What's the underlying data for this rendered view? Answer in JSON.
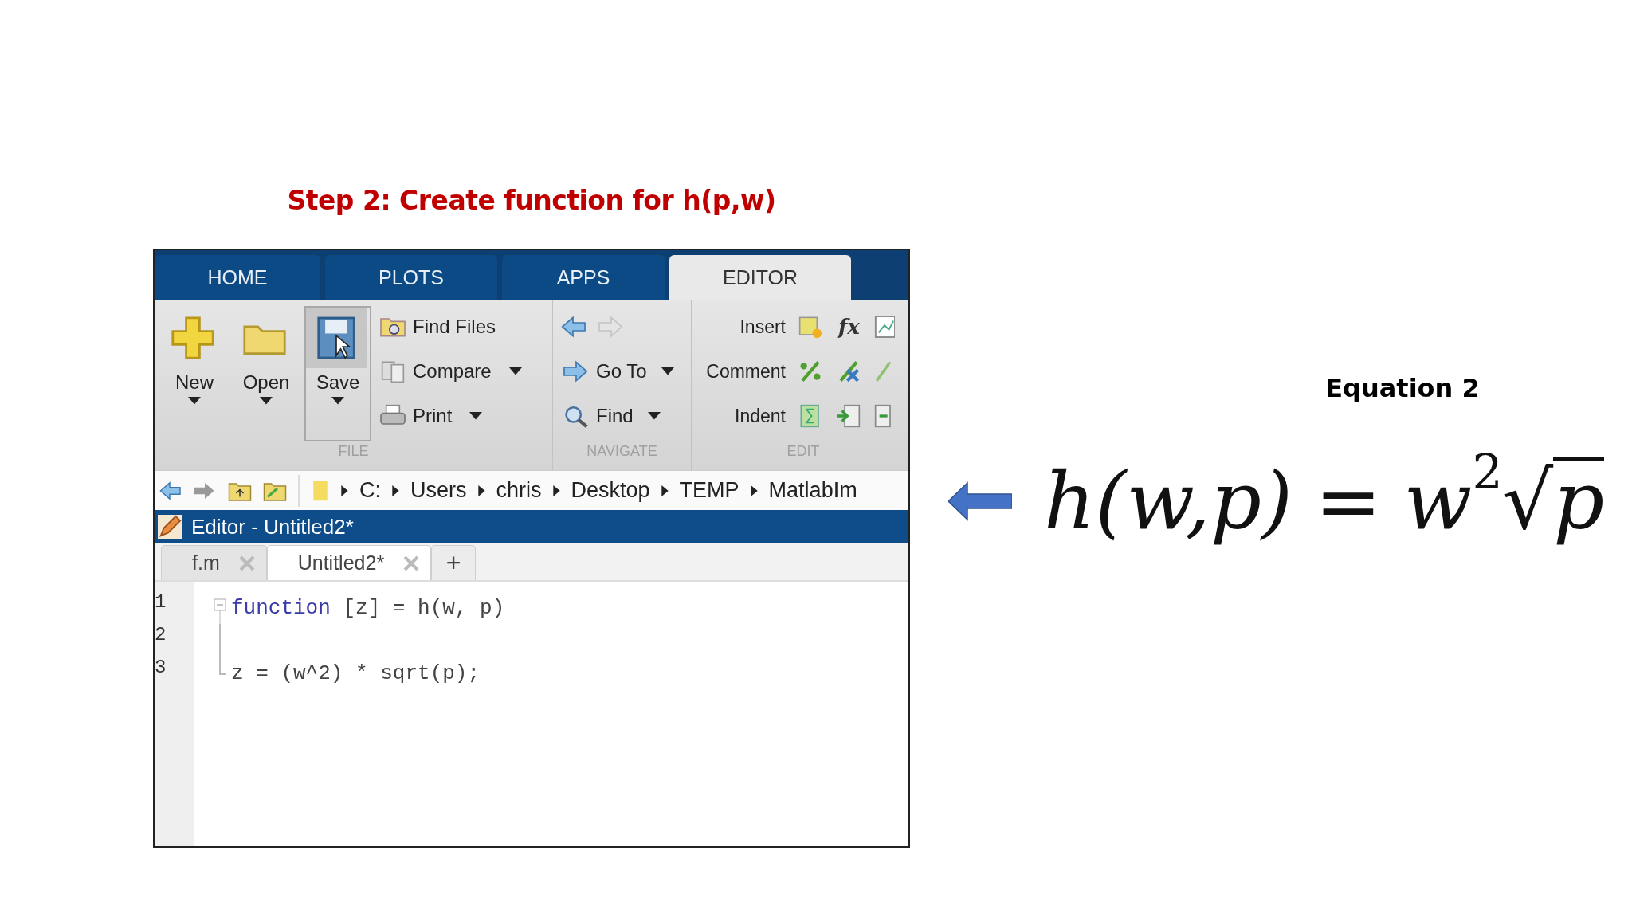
{
  "slide_title": "Step 2: Create function for h(p,w)",
  "matlab": {
    "tabs": [
      {
        "label": "HOME",
        "selected": false
      },
      {
        "label": "PLOTS",
        "selected": false
      },
      {
        "label": "APPS",
        "selected": false
      },
      {
        "label": "EDITOR",
        "selected": true
      }
    ],
    "ribbon": {
      "file": {
        "label": "FILE",
        "large_buttons": [
          {
            "kind": "new",
            "label": "New",
            "pressed": false
          },
          {
            "kind": "open",
            "label": "Open",
            "pressed": false
          },
          {
            "kind": "save",
            "label": "Save",
            "pressed": true
          }
        ],
        "small_buttons": [
          {
            "kind": "find-files",
            "label": "Find Files",
            "dropdown": false
          },
          {
            "kind": "compare",
            "label": "Compare",
            "dropdown": true
          },
          {
            "kind": "print",
            "label": "Print",
            "dropdown": true
          }
        ]
      },
      "navigate": {
        "label": "NAVIGATE",
        "buttons": [
          {
            "kind": "go-to",
            "label": "Go To",
            "dropdown": true
          },
          {
            "kind": "find",
            "label": "Find",
            "dropdown": true
          }
        ]
      },
      "edit": {
        "label": "EDIT",
        "rows": [
          {
            "kind": "insert",
            "label": "Insert",
            "function_label": "fx"
          },
          {
            "kind": "comment",
            "label": "Comment"
          },
          {
            "kind": "indent",
            "label": "Indent"
          }
        ]
      }
    },
    "path": [
      "C:",
      "Users",
      "chris",
      "Desktop",
      "TEMP",
      "MatlabIm"
    ],
    "editor_title": "Editor - Untitled2*",
    "documents": [
      {
        "name": "f.m",
        "selected": false
      },
      {
        "name": "Untitled2*",
        "selected": true
      }
    ],
    "new_tab": "+",
    "lines": [
      {
        "number": "1",
        "keyword": "function",
        "code": " [z] = h(w, p)"
      },
      {
        "number": "2"
      },
      {
        "number": "3",
        "code": "z = (w^2) * sqrt(p);"
      }
    ]
  },
  "equation_label": "Equation 2",
  "equation": {
    "lhs": "h(w,p)",
    "equals": "=",
    "base": "w",
    "exponent": "2",
    "radical": "√",
    "radicand": "p"
  }
}
